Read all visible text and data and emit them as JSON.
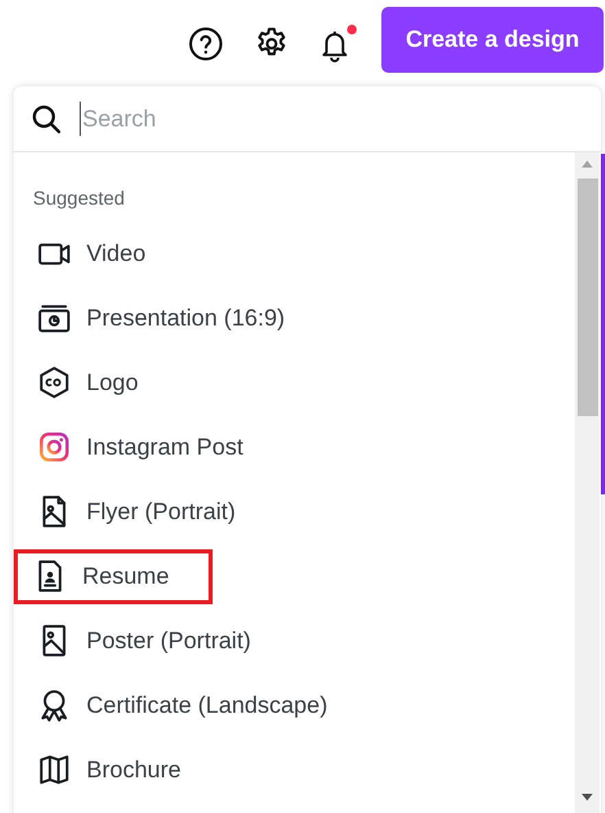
{
  "header": {
    "create_button": "Create a design",
    "notification_dot": true
  },
  "search": {
    "placeholder": "Search"
  },
  "section_title": "Suggested",
  "items": [
    {
      "label": "Video",
      "highlighted": false
    },
    {
      "label": "Presentation (16:9)",
      "highlighted": false
    },
    {
      "label": "Logo",
      "highlighted": false
    },
    {
      "label": "Instagram Post",
      "highlighted": false
    },
    {
      "label": "Flyer (Portrait)",
      "highlighted": false
    },
    {
      "label": "Resume",
      "highlighted": true
    },
    {
      "label": "Poster (Portrait)",
      "highlighted": false
    },
    {
      "label": "Certificate (Landscape)",
      "highlighted": false
    },
    {
      "label": "Brochure",
      "highlighted": false
    }
  ]
}
